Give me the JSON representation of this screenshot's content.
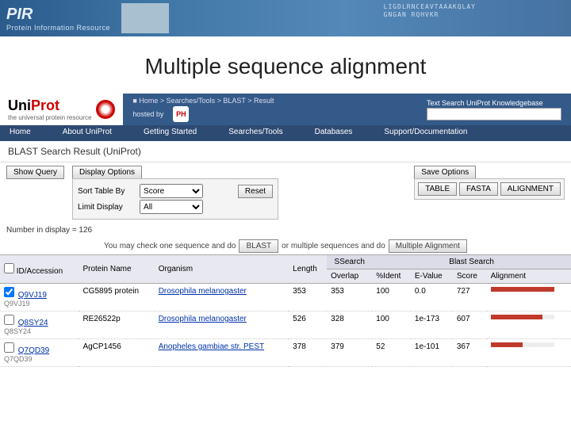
{
  "pir": {
    "name": "PIR",
    "full": "Protein Information Resource",
    "seq1": "LIGDLRNCEAVTAAAKQLAY",
    "seq2": "GNGAN       RQHVKR"
  },
  "title": "Multiple sequence alignment",
  "uni": {
    "logo1": "Uni",
    "logo2": "Prot",
    "tagline": "the universal protein resource",
    "hosted": "hosted by",
    "breadcrumb": "Home > Searches/Tools > BLAST > Result",
    "search_label": "Text Search UniProt Knowledgebase",
    "nav": [
      "Home",
      "About UniProt",
      "Getting Started",
      "Searches/Tools",
      "Databases",
      "Support/Documentation"
    ]
  },
  "page": {
    "subhead": "BLAST Search Result (UniProt)",
    "show_query": "Show Query",
    "display_options": "Display Options",
    "sort_label": "Sort Table By",
    "sort_value": "Score",
    "limit_label": "Limit Display",
    "limit_value": "All",
    "reset": "Reset",
    "save_options": "Save Options",
    "tabs": [
      "TABLE",
      "FASTA",
      "ALIGNMENT"
    ],
    "count": "Number in display = 126",
    "hint_pre": "You may check one sequence and do",
    "blast_btn": "BLAST",
    "hint_mid": "or multiple sequences and do",
    "ma_btn": "Multiple Alignment"
  },
  "table": {
    "headers": {
      "id": "ID/Accession",
      "protein": "Protein Name",
      "organism": "Organism",
      "length": "Length",
      "ssearch": "SSearch",
      "blast": "Blast Search",
      "overlap": "Overlap",
      "ident": "%Ident",
      "evalue": "E-Value",
      "score": "Score",
      "alignment": "Alignment"
    },
    "rows": [
      {
        "checked": true,
        "acc": "Q9VJ19",
        "acc2": "Q9VJ19",
        "protein": "CG5895 protein",
        "organism": "Drosophila melanogaster",
        "length": "353",
        "overlap": "353",
        "ident": "100",
        "evalue": "0.0",
        "score": "727",
        "bar": 100
      },
      {
        "checked": false,
        "acc": "Q8SY24",
        "acc2": "Q8SY24",
        "protein": "RE26522p",
        "organism": "Drosophila melanogaster",
        "length": "526",
        "overlap": "328",
        "ident": "100",
        "evalue": "1e-173",
        "score": "607",
        "bar": 82
      },
      {
        "checked": false,
        "acc": "Q7QD39",
        "acc2": "Q7QD39",
        "protein": "AgCP1456",
        "organism": "Anopheles gambiae str. PEST",
        "length": "378",
        "overlap": "379",
        "ident": "52",
        "evalue": "1e-101",
        "score": "367",
        "bar": 50
      }
    ]
  }
}
